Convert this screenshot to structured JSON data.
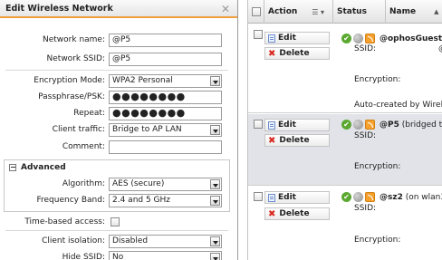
{
  "dialog": {
    "title": "Edit Wireless Network",
    "close_glyph": "✕",
    "fields": {
      "network_name": {
        "label": "Network name:",
        "value": "@P5"
      },
      "network_ssid": {
        "label": "Network SSID:",
        "value": "@P5"
      },
      "encryption_mode": {
        "label": "Encryption Mode:",
        "value": "WPA2 Personal"
      },
      "passphrase": {
        "label": "Passphrase/PSK:",
        "value": "●●●●●●●●"
      },
      "repeat": {
        "label": "Repeat:",
        "value": "●●●●●●●●"
      },
      "client_traffic": {
        "label": "Client traffic:",
        "value": "Bridge to AP LAN"
      },
      "comment": {
        "label": "Comment:",
        "value": ""
      }
    },
    "advanced": {
      "toggle_glyph": "−",
      "title": "Advanced",
      "algorithm": {
        "label": "Algorithm:",
        "value": "AES (secure)"
      },
      "frequency_band": {
        "label": "Frequency Band:",
        "value": "2.4 and 5 GHz"
      }
    },
    "time_based_access": {
      "label": "Time-based access:"
    },
    "client_isolation": {
      "label": "Client isolation:",
      "value": "Disabled"
    },
    "hide_ssid": {
      "label": "Hide SSID:",
      "value": "No"
    }
  },
  "grid": {
    "headers": {
      "action": "Action",
      "menu": "☰ ▾",
      "status": "Status",
      "name": "Name",
      "sort": "▲"
    },
    "edit_label": "Edit",
    "delete_label": "Delete",
    "delete_glyph": "✖",
    "ok_glyph": "✔",
    "ssid_label": "SSID:",
    "encryption_label": "Encryption:",
    "rows": [
      {
        "name": "@ophosGuest",
        "name_suffix": " (",
        "ssid_value": "@",
        "note": "Auto-created by Wireles"
      },
      {
        "name": "@P5",
        "name_suffix": " (bridged t"
      },
      {
        "name": "@sz2",
        "name_suffix": " (on wlan3"
      }
    ]
  },
  "colors": {
    "accent": "#f0a040",
    "ok": "#5aa830",
    "delete": "#d8281e",
    "selected_row": "#e2e3e8"
  }
}
